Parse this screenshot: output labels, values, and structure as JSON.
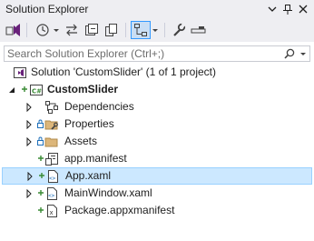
{
  "window": {
    "title": "Solution Explorer",
    "buttons": [
      "dropdown",
      "pin",
      "close"
    ]
  },
  "toolbar": {
    "icons": [
      "vs-switch-views-icon",
      "history-icon",
      "sync-icon",
      "collapse-all-icon",
      "show-all-files-icon",
      "track-active-icon",
      "properties-wrench-icon",
      "preview-icon"
    ]
  },
  "search": {
    "placeholder": "Search Solution Explorer (Ctrl+;)"
  },
  "tree": {
    "solution": "Solution 'CustomSlider' (1 of 1 project)",
    "project": "CustomSlider",
    "project_badge": "C#",
    "items": [
      {
        "label": "Dependencies",
        "expandable": true
      },
      {
        "label": "Properties",
        "expandable": true
      },
      {
        "label": "Assets",
        "expandable": true
      },
      {
        "label": "app.manifest",
        "expandable": false
      },
      {
        "label": "App.xaml",
        "expandable": true,
        "selected": true
      },
      {
        "label": "MainWindow.xaml",
        "expandable": true
      },
      {
        "label": "Package.appxmanifest",
        "expandable": false
      }
    ]
  },
  "colors": {
    "accent": "#68217a",
    "selection_bg": "#cce8ff",
    "selection_border": "#99d1ff",
    "add_green": "#388a34",
    "lock_blue": "#1e6fb9"
  }
}
